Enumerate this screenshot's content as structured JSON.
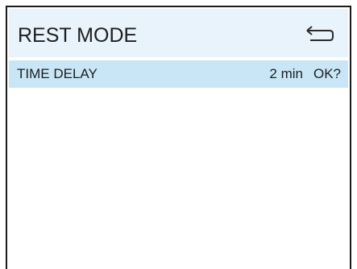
{
  "screen": {
    "title": "REST MODE",
    "back_icon": "return-arrow-icon"
  },
  "settings": [
    {
      "label": "TIME DELAY",
      "value": "2 min",
      "confirm": "OK?"
    }
  ],
  "colors": {
    "header_bg": "#e8f3fb",
    "selected_row_bg": "#c9e6f6",
    "border": "#1a1a1a",
    "text": "#1e1e1e"
  }
}
